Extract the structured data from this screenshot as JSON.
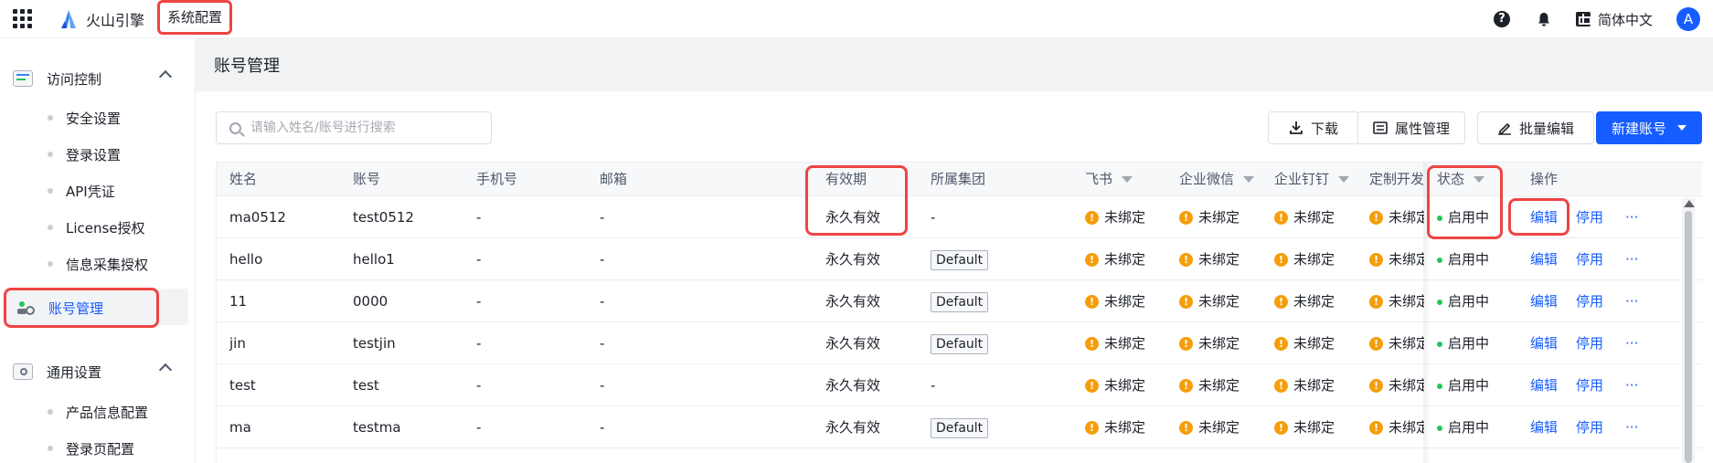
{
  "topbar": {
    "brand": "火山引擎",
    "breadcrumb": "系统配置",
    "language": "简体中文",
    "avatar_initial": "A"
  },
  "sidebar": {
    "groups": [
      {
        "label": "访问控制",
        "items": [
          "安全设置",
          "登录设置",
          "API凭证",
          "License授权",
          "信息采集授权"
        ]
      },
      {
        "label": "账号管理"
      },
      {
        "label": "通用设置",
        "items": [
          "产品信息配置",
          "登录页配置"
        ]
      }
    ]
  },
  "page": {
    "title": "账号管理",
    "search_placeholder": "请输入姓名/账号进行搜索",
    "buttons": {
      "download": "下载",
      "attribute": "属性管理",
      "batch_edit": "批量编辑",
      "new_account": "新建账号"
    }
  },
  "table": {
    "columns": [
      "姓名",
      "账号",
      "手机号",
      "邮箱",
      "有效期",
      "所属集团",
      "飞书",
      "企业微信",
      "企业钉钉",
      "定制开发",
      "状态",
      "操作"
    ],
    "rows": [
      {
        "name": "ma0512",
        "account": "test0512",
        "phone": "-",
        "email": "-",
        "validity": "永久有效",
        "group": "-",
        "feishu": "未绑定",
        "wecom": "未绑定",
        "dingtalk": "未绑定",
        "custom": "未绑定",
        "status": "启用中",
        "edit": "编辑",
        "disable": "停用",
        "more": "···"
      },
      {
        "name": "hello",
        "account": "hello1",
        "phone": "-",
        "email": "-",
        "validity": "永久有效",
        "group": "Default",
        "feishu": "未绑定",
        "wecom": "未绑定",
        "dingtalk": "未绑定",
        "custom": "未绑定",
        "status": "启用中",
        "edit": "编辑",
        "disable": "停用",
        "more": "···"
      },
      {
        "name": "11",
        "account": "0000",
        "phone": "-",
        "email": "-",
        "validity": "永久有效",
        "group": "Default",
        "feishu": "未绑定",
        "wecom": "未绑定",
        "dingtalk": "未绑定",
        "custom": "未绑定",
        "status": "启用中",
        "edit": "编辑",
        "disable": "停用",
        "more": "···"
      },
      {
        "name": "jin",
        "account": "testjin",
        "phone": "-",
        "email": "-",
        "validity": "永久有效",
        "group": "Default",
        "feishu": "未绑定",
        "wecom": "未绑定",
        "dingtalk": "未绑定",
        "custom": "未绑定",
        "status": "启用中",
        "edit": "编辑",
        "disable": "停用",
        "more": "···"
      },
      {
        "name": "test",
        "account": "test",
        "phone": "-",
        "email": "-",
        "validity": "永久有效",
        "group": "-",
        "feishu": "未绑定",
        "wecom": "未绑定",
        "dingtalk": "未绑定",
        "custom": "未绑定",
        "status": "启用中",
        "edit": "编辑",
        "disable": "停用",
        "more": "···"
      },
      {
        "name": "ma",
        "account": "testma",
        "phone": "-",
        "email": "-",
        "validity": "永久有效",
        "group": "Default",
        "feishu": "未绑定",
        "wecom": "未绑定",
        "dingtalk": "未绑定",
        "custom": "未绑定",
        "status": "启用中",
        "edit": "编辑",
        "disable": "停用",
        "more": "···"
      }
    ]
  },
  "colors": {
    "primary": "#165dff",
    "highlight": "#ef4444",
    "status_active": "#22c55e",
    "warning": "#f59e0b"
  }
}
